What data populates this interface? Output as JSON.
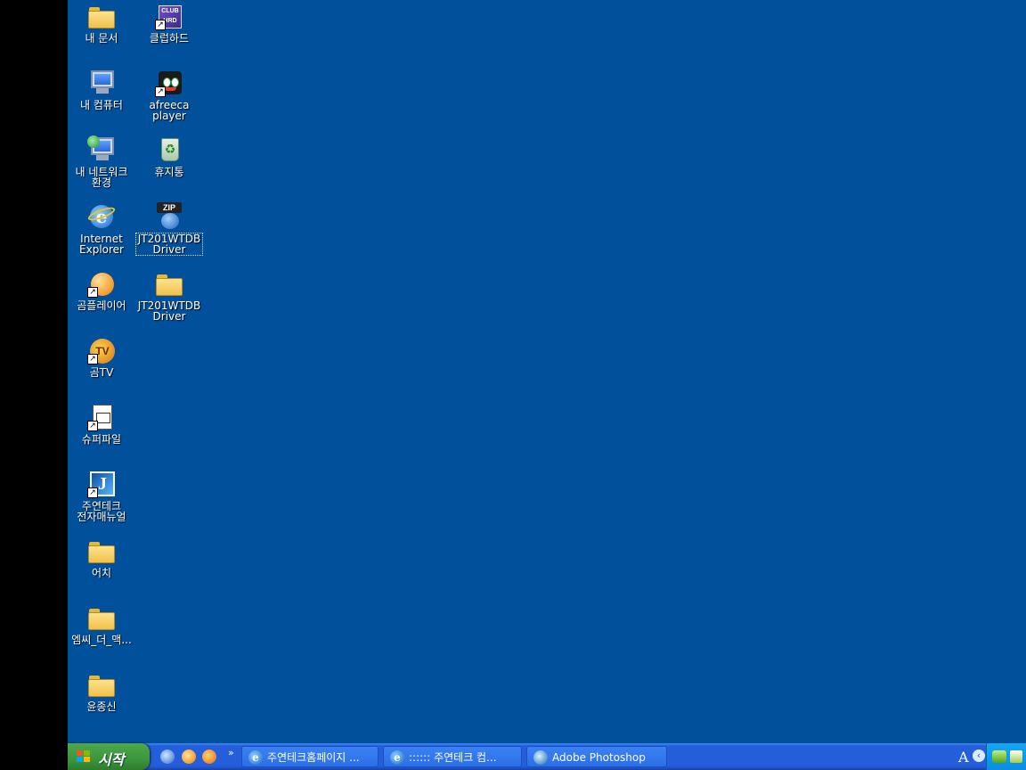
{
  "desktop": {
    "background": "#00509c",
    "icons": [
      {
        "label": "내 문서",
        "icon": "my-documents-icon"
      },
      {
        "label": "클럽하드",
        "icon": "clubhard-icon"
      },
      {
        "label": "내 컴퓨터",
        "icon": "my-computer-icon"
      },
      {
        "label": "afreeca\nplayer",
        "icon": "afreeca-player-icon"
      },
      {
        "label": "내 네트워크\n환경",
        "icon": "my-network-icon"
      },
      {
        "label": "휴지통",
        "icon": "recycle-bin-icon"
      },
      {
        "label": "Internet\nExplorer",
        "icon": "internet-explorer-icon"
      },
      {
        "label": "JT201WTDB\nDriver",
        "icon": "zip-archive-icon"
      },
      {
        "label": "곰플레이어",
        "icon": "gom-player-icon"
      },
      {
        "label": "JT201WTDB\nDriver",
        "icon": "folder-icon"
      },
      {
        "label": "곰TV",
        "icon": "gomtv-icon"
      },
      {
        "label": "슈퍼파일",
        "icon": "superfile-icon"
      },
      {
        "label": "주연테크\n전자매뉴얼",
        "icon": "jooyontech-manual-icon"
      },
      {
        "label": "어치",
        "icon": "folder-icon"
      },
      {
        "label": "엠씨_더_맥...",
        "icon": "folder-icon"
      },
      {
        "label": "윤종신",
        "icon": "folder-icon"
      }
    ]
  },
  "taskbar": {
    "start_label": "시작",
    "tasks": [
      {
        "label": "주연테크홈페이지 ...",
        "icon": "internet-explorer-icon"
      },
      {
        "label": ":::::: 주연테크 컴...",
        "icon": "internet-explorer-icon"
      },
      {
        "label": "Adobe Photoshop",
        "icon": "photoshop-icon"
      }
    ],
    "lang_indicator": "A",
    "quick_launch_overflow": "»"
  }
}
